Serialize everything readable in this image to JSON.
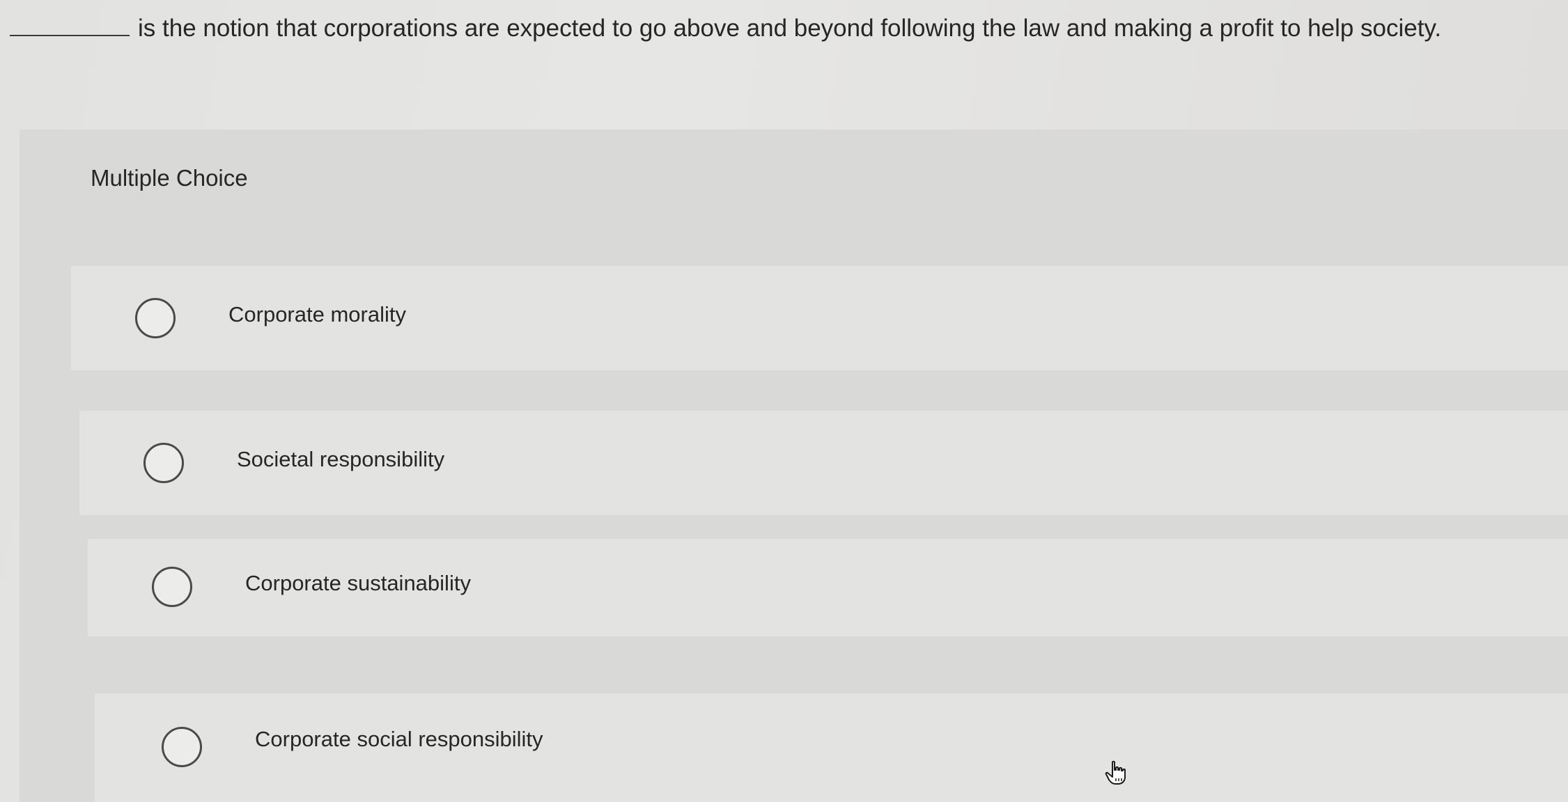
{
  "question": {
    "text": "is the notion that corporations are expected to go above and beyond following the law and making a profit to help society."
  },
  "panel": {
    "title": "Multiple Choice",
    "choices": [
      {
        "label": "Corporate morality"
      },
      {
        "label": "Societal responsibility"
      },
      {
        "label": "Corporate sustainability"
      },
      {
        "label": "Corporate social responsibility"
      }
    ]
  },
  "icons": {
    "radio": "radio-button-icon",
    "cursor": "hand-pointer-cursor-icon"
  },
  "colors": {
    "text": "#262626",
    "panel": "#d9d9d7",
    "choice": "#e3e3e1"
  }
}
